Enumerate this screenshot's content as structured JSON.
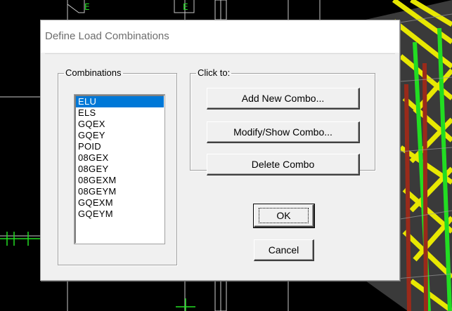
{
  "dialog": {
    "title": "Define Load Combinations",
    "combinations_label": "Combinations",
    "click_to_label": "Click to:",
    "combinations": [
      "ELU",
      "ELS",
      "GQEX",
      "GQEY",
      "POID",
      "08GEX",
      "08GEY",
      "08GEXM",
      "08GEYM",
      "GQEXM",
      "GQEYM"
    ],
    "selected": "ELU",
    "buttons": {
      "add": "Add New Combo...",
      "modify": "Modify/Show Combo...",
      "delete": "Delete Combo",
      "ok": "OK",
      "cancel": "Cancel"
    }
  },
  "background": {
    "viewport_color": "#000000",
    "accent_yellow": "#f2f200",
    "accent_green": "#22dd22",
    "accent_red": "#9a2a1a"
  }
}
